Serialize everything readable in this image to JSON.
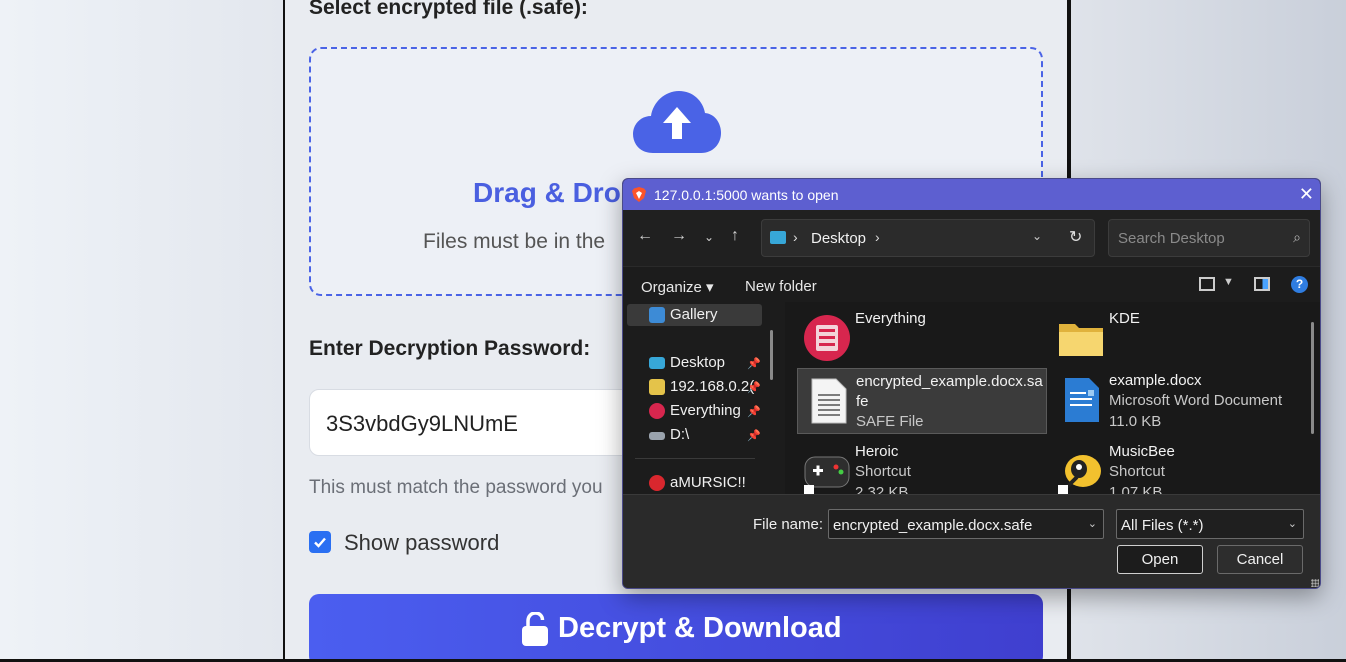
{
  "page": {
    "file_label": "Select encrypted file (.safe):",
    "dropzone_title": "Drag & Drop",
    "dropzone_sub": "Files must be in the",
    "password_label": "Enter Decryption Password:",
    "password_value": "3S3vbdGy9LNUmE",
    "password_hint": "This must match the password you",
    "show_password": "Show password",
    "show_password_checked": true,
    "decrypt_button": "Decrypt & Download",
    "accent_color": "#4a5fe0"
  },
  "dialog": {
    "title": "127.0.0.1:5000 wants to open",
    "close": "✕",
    "address": "Desktop",
    "search_placeholder": "Search Desktop",
    "toolbar": {
      "organize": "Organize ▾",
      "new_folder": "New folder"
    },
    "nav_items": [
      {
        "label": "Gallery",
        "icon": "gallery-icon",
        "pinned": false,
        "selected": true
      },
      {
        "label": "Desktop",
        "icon": "desktop-icon",
        "pinned": true
      },
      {
        "label": "192.168.0.2(",
        "icon": "network-drive-icon",
        "pinned": true
      },
      {
        "label": "Everything",
        "icon": "everything-icon",
        "pinned": true
      },
      {
        "label": "D:\\",
        "icon": "drive-icon",
        "pinned": true
      },
      {
        "label": "aMURSIC!!",
        "icon": "mega-icon",
        "pinned": false
      }
    ],
    "files": [
      {
        "name": "Everything",
        "sub1": "",
        "sub2": "",
        "icon": "everything-app-icon"
      },
      {
        "name": "KDE",
        "sub1": "",
        "sub2": "",
        "icon": "folder-icon"
      },
      {
        "name": "encrypted_example.docx.safe",
        "sub1": "SAFE File",
        "sub2": "",
        "icon": "document-icon",
        "selected": true
      },
      {
        "name": "example.docx",
        "sub1": "Microsoft Word Document",
        "sub2": "11.0 KB",
        "icon": "word-icon"
      },
      {
        "name": "Heroic",
        "sub1": "Shortcut",
        "sub2": "2.32 KB",
        "icon": "heroic-icon"
      },
      {
        "name": "MusicBee",
        "sub1": "Shortcut",
        "sub2": "1.07 KB",
        "icon": "musicbee-icon"
      }
    ],
    "file_name_label": "File name:",
    "file_name_value": "encrypted_example.docx.safe",
    "file_type_value": "All Files (*.*)",
    "open_button": "Open",
    "cancel_button": "Cancel"
  }
}
